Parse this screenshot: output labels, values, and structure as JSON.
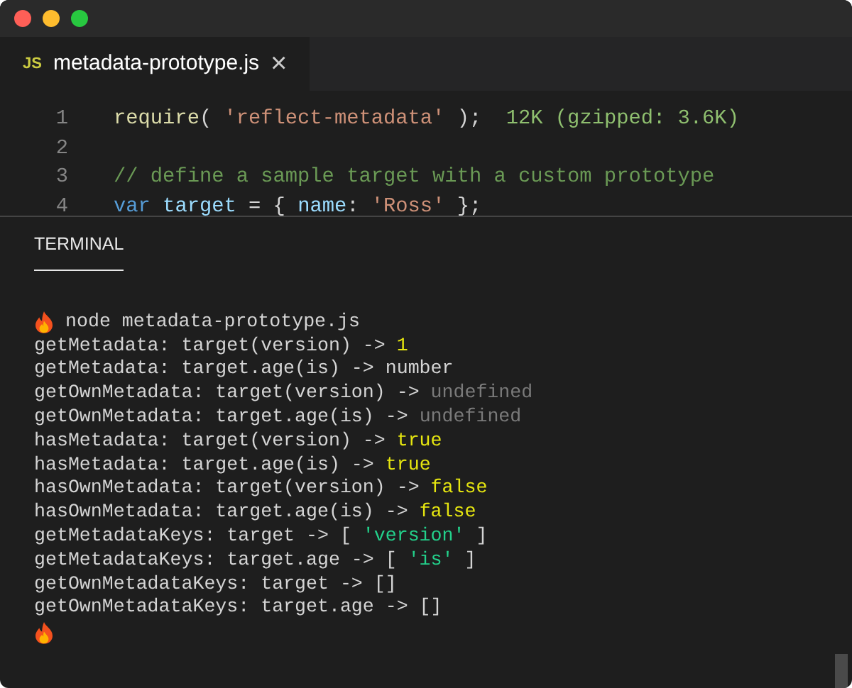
{
  "window": {
    "controls": [
      {
        "color": "#fe5f57"
      },
      {
        "color": "#febc2e"
      },
      {
        "color": "#28c840"
      }
    ]
  },
  "tabs": [
    {
      "icon": "JS",
      "label": "metadata-prototype.js",
      "selected": true,
      "close": "×"
    }
  ],
  "editor": {
    "lines": [
      {
        "number": "1",
        "tokens": [
          {
            "kind": "fn",
            "text": "require"
          },
          {
            "kind": "punc",
            "text": "( "
          },
          {
            "kind": "str",
            "text": "'reflect-metadata'"
          },
          {
            "kind": "punc",
            "text": " );  "
          },
          {
            "kind": "hint",
            "text": "12K (gzipped: 3.6K)"
          }
        ]
      },
      {
        "number": "2"
      },
      {
        "number": "3",
        "tokens": [
          {
            "kind": "comment",
            "text": "// define a sample target with a custom prototype"
          }
        ]
      },
      {
        "number": "4",
        "tokens": [
          {
            "kind": "kw",
            "text": "var"
          },
          {
            "kind": "var",
            "text": " target"
          },
          {
            "kind": "punc",
            "text": " = { "
          },
          {
            "kind": "var",
            "text": "name"
          },
          {
            "kind": "punc",
            "text": ": "
          },
          {
            "kind": "str",
            "text": "'Ross'"
          },
          {
            "kind": "punc",
            "text": " };"
          }
        ]
      }
    ]
  },
  "panel": {
    "tabs": [
      {
        "label": "TERMINAL",
        "selected": true
      }
    ],
    "terminal": [
      {
        "prompt": true,
        "parts": [
          {
            "kind": "plain",
            "text": "node metadata-prototype.js"
          }
        ]
      },
      {
        "prompt": false,
        "parts": [
          {
            "kind": "plain",
            "text": "getMetadata: target(version) -> "
          },
          {
            "kind": "value",
            "text": "1"
          }
        ]
      },
      {
        "prompt": false,
        "parts": [
          {
            "kind": "plain",
            "text": "getMetadata: target.age(is) -> number"
          }
        ]
      },
      {
        "prompt": false,
        "parts": [
          {
            "kind": "plain",
            "text": "getOwnMetadata: target(version) -> "
          },
          {
            "kind": "dim",
            "text": "undefined"
          }
        ]
      },
      {
        "prompt": false,
        "parts": [
          {
            "kind": "plain",
            "text": "getOwnMetadata: target.age(is) -> "
          },
          {
            "kind": "dim",
            "text": "undefined"
          }
        ]
      },
      {
        "prompt": false,
        "parts": [
          {
            "kind": "plain",
            "text": "hasMetadata: target(version) -> "
          },
          {
            "kind": "value",
            "text": "true"
          }
        ]
      },
      {
        "prompt": false,
        "parts": [
          {
            "kind": "plain",
            "text": "hasMetadata: target.age(is) -> "
          },
          {
            "kind": "value",
            "text": "true"
          }
        ]
      },
      {
        "prompt": false,
        "parts": [
          {
            "kind": "plain",
            "text": "hasOwnMetadata: target(version) -> "
          },
          {
            "kind": "value",
            "text": "false"
          }
        ]
      },
      {
        "prompt": false,
        "parts": [
          {
            "kind": "plain",
            "text": "hasOwnMetadata: target.age(is) -> "
          },
          {
            "kind": "value",
            "text": "false"
          }
        ]
      },
      {
        "prompt": false,
        "parts": [
          {
            "kind": "plain",
            "text": "getMetadataKeys: target -> [ "
          },
          {
            "kind": "string",
            "text": "'version'"
          },
          {
            "kind": "plain",
            "text": " ]"
          }
        ]
      },
      {
        "prompt": false,
        "parts": [
          {
            "kind": "plain",
            "text": "getMetadataKeys: target.age -> [ "
          },
          {
            "kind": "string",
            "text": "'is'"
          },
          {
            "kind": "plain",
            "text": " ]"
          }
        ]
      },
      {
        "prompt": false,
        "parts": [
          {
            "kind": "plain",
            "text": "getOwnMetadataKeys: target -> []"
          }
        ]
      },
      {
        "prompt": false,
        "parts": [
          {
            "kind": "plain",
            "text": "getOwnMetadataKeys: target.age -> []"
          }
        ]
      },
      {
        "prompt": true
      }
    ]
  }
}
